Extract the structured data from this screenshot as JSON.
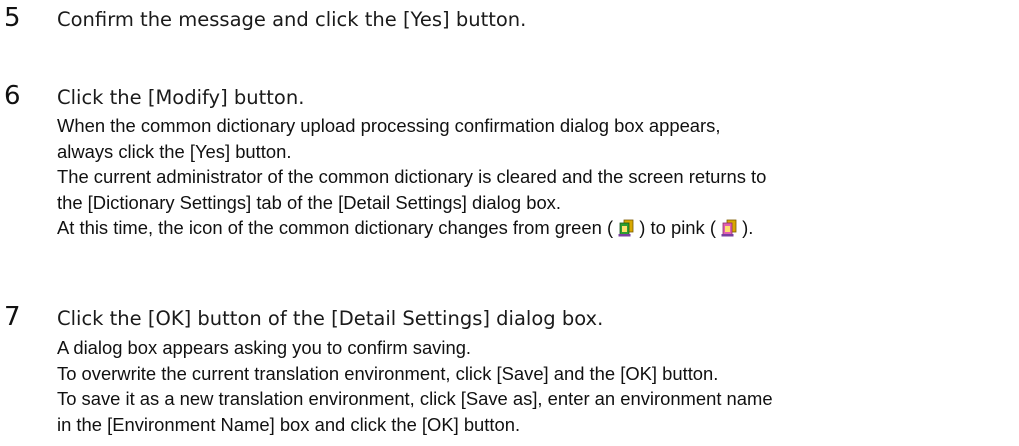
{
  "steps": [
    {
      "number": "5",
      "title": "Confirm the message and click the [Yes] button.",
      "lines": []
    },
    {
      "number": "6",
      "title": "Click the [Modify] button.",
      "lines": [
        "When the common dictionary upload processing confirmation dialog box appears,",
        "always click the [Yes] button.",
        "The current administrator of the common dictionary is cleared and the screen returns to",
        "the [Dictionary Settings] tab of the [Detail Settings] dialog box."
      ],
      "icon_line": {
        "part1": "At this time, the icon of the common dictionary changes from green ( ",
        "part2": " ) to pink ( ",
        "part3": " ).",
        "icon_green": "dictionary-green-icon",
        "icon_pink": "dictionary-pink-icon"
      }
    },
    {
      "number": "7",
      "title": "Click the [OK] button of the [Detail Settings] dialog box.",
      "lines": [
        "A dialog box appears asking you to confirm saving.",
        "To overwrite the current translation environment, click [Save] and the [OK] button.",
        "To save it as a new translation environment, click [Save as], enter an environment name",
        "in the [Environment Name] box and click the [OK] button."
      ]
    }
  ],
  "colors": {
    "icon_green": "#2e9e2e",
    "icon_pink": "#e060b0",
    "icon_gold": "#d8a800"
  }
}
